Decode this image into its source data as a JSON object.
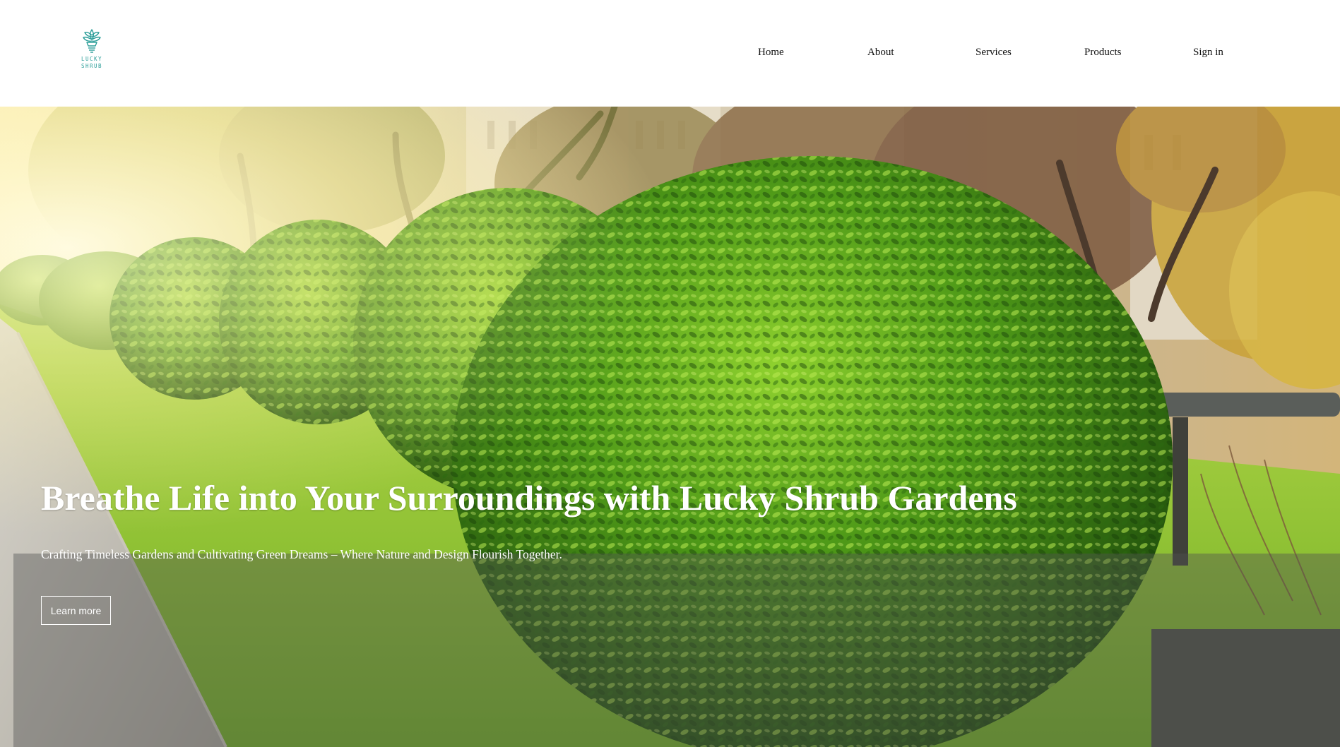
{
  "brand": {
    "logo_line1": "LUCKY",
    "logo_line2": "SHRUB",
    "logo_color": "#2a9d98"
  },
  "nav": {
    "items": [
      {
        "label": "Home"
      },
      {
        "label": "About"
      },
      {
        "label": "Services"
      },
      {
        "label": "Products"
      },
      {
        "label": "Sign in"
      }
    ]
  },
  "hero": {
    "title": "Breathe Life into Your Surroundings with Lucky Shrub Gardens",
    "subtitle": "Crafting Timeless Gardens and Cultivating Green Dreams – Where Nature and Design Flourish Together.",
    "cta_label": "Learn more",
    "image_icon": "topiary-garden-photo"
  }
}
